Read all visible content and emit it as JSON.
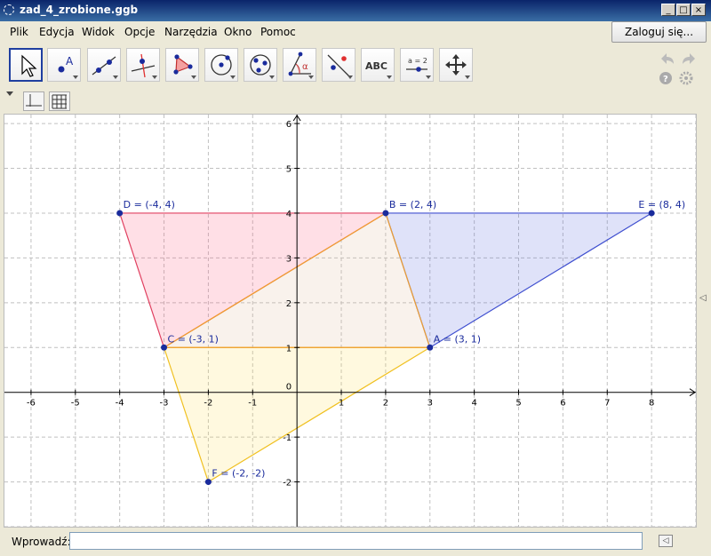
{
  "window": {
    "title": "zad_4_zrobione.ggb",
    "buttons": [
      "_",
      "□",
      "×"
    ]
  },
  "menu": {
    "items": [
      "Plik",
      "Edycja",
      "Widok",
      "Opcje",
      "Narzędzia",
      "Okno",
      "Pomoc"
    ],
    "login_label": "Zaloguj się..."
  },
  "toolbar": {
    "tools": [
      {
        "name": "move-tool",
        "selected": true
      },
      {
        "name": "point-tool",
        "text": "A"
      },
      {
        "name": "line-tool"
      },
      {
        "name": "perpendicular-line-tool"
      },
      {
        "name": "polygon-tool"
      },
      {
        "name": "circle-tool"
      },
      {
        "name": "conic-tool"
      },
      {
        "name": "angle-tool",
        "text": "α"
      },
      {
        "name": "reflect-tool"
      },
      {
        "name": "text-tool",
        "text": "ABC"
      },
      {
        "name": "slider-tool",
        "text": "a = 2"
      },
      {
        "name": "move-graphics-view-tool"
      }
    ],
    "undo_icon": "undo-icon",
    "redo_icon": "redo-icon",
    "help_icon": "help-icon",
    "settings_icon": "gear-icon"
  },
  "input_bar": {
    "label": "Wprowadź:",
    "value": "",
    "placeholder": ""
  },
  "chart_data": {
    "type": "scatter",
    "x_ticks": [
      "-6",
      "-5",
      "-4",
      "-3",
      "-2",
      "-1",
      "0",
      "1",
      "2",
      "3",
      "4",
      "5",
      "6",
      "7",
      "8"
    ],
    "y_ticks": [
      "-2",
      "-1",
      "1",
      "2",
      "3",
      "4",
      "5",
      "6"
    ],
    "origin_label": "0",
    "xlim": [
      -6.6,
      9.0
    ],
    "ylim": [
      -3.0,
      6.2
    ],
    "grid": true,
    "points": [
      {
        "name": "A",
        "label": "A = (3, 1)",
        "x": 3,
        "y": 1
      },
      {
        "name": "B",
        "label": "B = (2, 4)",
        "x": 2,
        "y": 4
      },
      {
        "name": "C",
        "label": "C = (-3, 1)",
        "x": -3,
        "y": 1
      },
      {
        "name": "D",
        "label": "D = (-4, 4)",
        "x": -4,
        "y": 4
      },
      {
        "name": "E",
        "label": "E = (8, 4)",
        "x": 8,
        "y": 4
      },
      {
        "name": "F",
        "label": "F = (-2, -2)",
        "x": -2,
        "y": -2
      }
    ],
    "polygons": [
      {
        "name": "polygon-ABE",
        "vertices": [
          "A",
          "B",
          "E"
        ],
        "fill": "#6070e0",
        "stroke": "#4050d0"
      },
      {
        "name": "polygon-CDB",
        "vertices": [
          "C",
          "D",
          "B"
        ],
        "fill": "#ff6080",
        "stroke": "#e04060"
      },
      {
        "name": "polygon-CAF",
        "vertices": [
          "C",
          "A",
          "F"
        ],
        "fill": "#ffe060",
        "stroke": "#f0c020"
      },
      {
        "name": "polygon-CBA",
        "vertices": [
          "C",
          "B",
          "A"
        ],
        "fill": "#e0c0a0",
        "stroke": "#f0a030"
      }
    ],
    "colors": {
      "point": "#1a2b9c",
      "label": "#1a2b9c",
      "grid": "#c0c0c0",
      "axis": "#000000"
    }
  }
}
